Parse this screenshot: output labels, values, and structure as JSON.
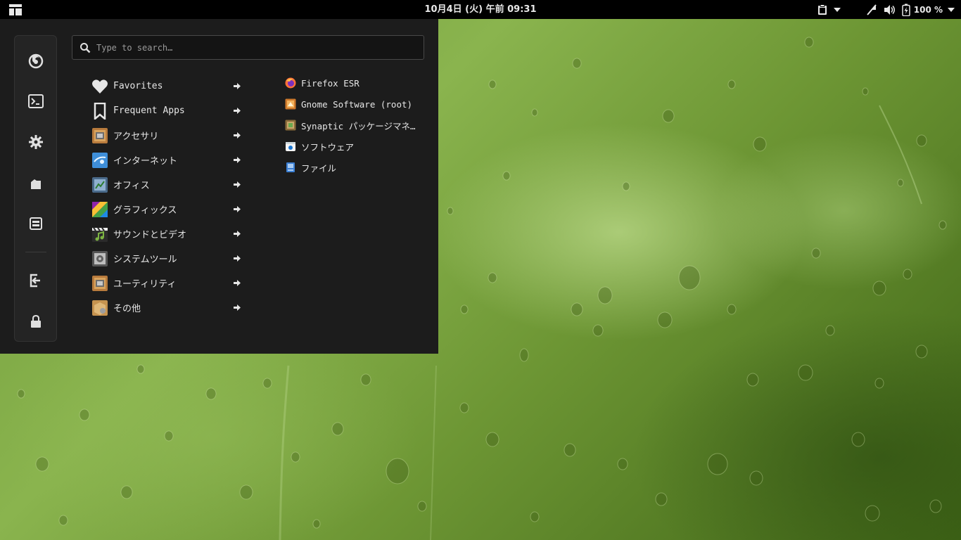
{
  "panel": {
    "clock": "10月4日 (火) 午前 09:31",
    "battery_percent": "100 %"
  },
  "menu": {
    "search": {
      "placeholder": "Type to search…",
      "value": ""
    },
    "sidebar": [
      {
        "name": "firefox-icon"
      },
      {
        "name": "terminal-icon"
      },
      {
        "name": "settings-gear-icon"
      },
      {
        "name": "file-manager-icon"
      },
      {
        "name": "software-center-icon"
      },
      {
        "name": "logout-icon"
      },
      {
        "name": "lock-icon"
      }
    ],
    "categories": [
      {
        "label": "Favorites",
        "icon": "heart-icon"
      },
      {
        "label": "Frequent Apps",
        "icon": "bookmark-icon"
      },
      {
        "label": "アクセサリ",
        "icon": "accessories-icon"
      },
      {
        "label": "インターネット",
        "icon": "internet-icon"
      },
      {
        "label": "オフィス",
        "icon": "office-icon"
      },
      {
        "label": "グラフィックス",
        "icon": "graphics-icon"
      },
      {
        "label": "サウンドとビデオ",
        "icon": "multimedia-icon"
      },
      {
        "label": "システムツール",
        "icon": "system-tools-icon"
      },
      {
        "label": "ユーティリティ",
        "icon": "utilities-icon"
      },
      {
        "label": "その他",
        "icon": "other-icon"
      }
    ],
    "apps": [
      {
        "label": "Firefox ESR",
        "icon": "firefox-icon"
      },
      {
        "label": "Gnome Software (root)",
        "icon": "gnome-software-icon"
      },
      {
        "label": "Synaptic パッケージマネ…",
        "icon": "synaptic-icon"
      },
      {
        "label": "ソフトウェア",
        "icon": "software-icon"
      },
      {
        "label": "ファイル",
        "icon": "files-icon"
      }
    ]
  }
}
